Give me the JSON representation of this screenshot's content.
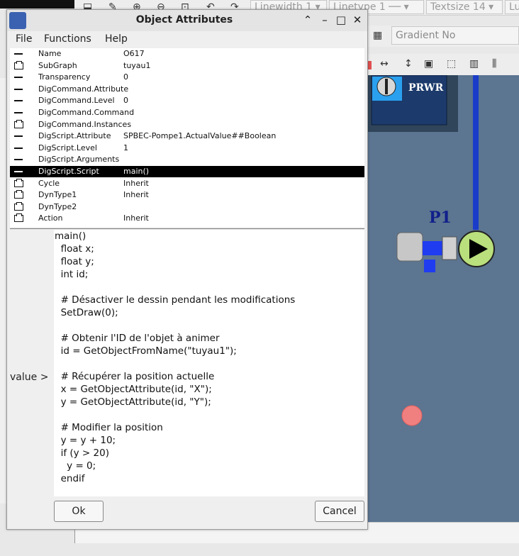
{
  "dialog": {
    "title": "Object Attributes",
    "menu": [
      "File",
      "Functions",
      "Help"
    ],
    "attributes": [
      {
        "icon": "dash",
        "name": "Name",
        "value": "O617"
      },
      {
        "icon": "folder",
        "name": "SubGraph",
        "value": "tuyau1"
      },
      {
        "icon": "dash",
        "name": "Transparency",
        "value": "0"
      },
      {
        "icon": "dash",
        "name": "DigCommand.Attribute",
        "value": ""
      },
      {
        "icon": "dash",
        "name": "DigCommand.Level",
        "value": "0"
      },
      {
        "icon": "dash",
        "name": "DigCommand.Command",
        "value": ""
      },
      {
        "icon": "folder",
        "name": "DigCommand.Instances",
        "value": ""
      },
      {
        "icon": "dash",
        "name": "DigScript.Attribute",
        "value": "SPBEC-Pompe1.ActualValue##Boolean"
      },
      {
        "icon": "dash",
        "name": "DigScript.Level",
        "value": "1"
      },
      {
        "icon": "dash",
        "name": "DigScript.Arguments",
        "value": ""
      },
      {
        "icon": "dash",
        "name": "DigScript.Script",
        "value": "main()",
        "selected": true
      },
      {
        "icon": "folder",
        "name": "Cycle",
        "value": "Inherit"
      },
      {
        "icon": "folder",
        "name": "DynType1",
        "value": "Inherit"
      },
      {
        "icon": "folder",
        "name": "DynType2",
        "value": ""
      },
      {
        "icon": "folder",
        "name": "Action",
        "value": "Inherit"
      }
    ],
    "value_label": "value >",
    "script": "main()\n  float x;\n  float y;\n  int id;\n\n  # Désactiver le dessin pendant les modifications\n  SetDraw(0);\n\n  # Obtenir l'ID de l'objet à animer\n  id = GetObjectFromName(\"tuyau1\");\n\n  # Récupérer la position actuelle\n  x = GetObjectAttribute(id, \"X\");\n  y = GetObjectAttribute(id, \"Y\");\n\n  # Modifier la position\n  y = y + 10;\n  if (y > 20)\n    y = 0;\n  endif",
    "ok_label": "Ok",
    "cancel_label": "Cancel"
  },
  "editor": {
    "linewidth": "Linewidth 1",
    "linetype": "Linetype 1",
    "textsize": "Textsize 14",
    "gradient": "Gradient No",
    "edge_text": "Lu",
    "panel_label": "PRWR",
    "pump_label": "P1"
  },
  "colors": {
    "canvas": "#5c7590",
    "pipe": "#1a3cc8",
    "pump_start": "#b9e07c",
    "alarm": "#f08080"
  }
}
